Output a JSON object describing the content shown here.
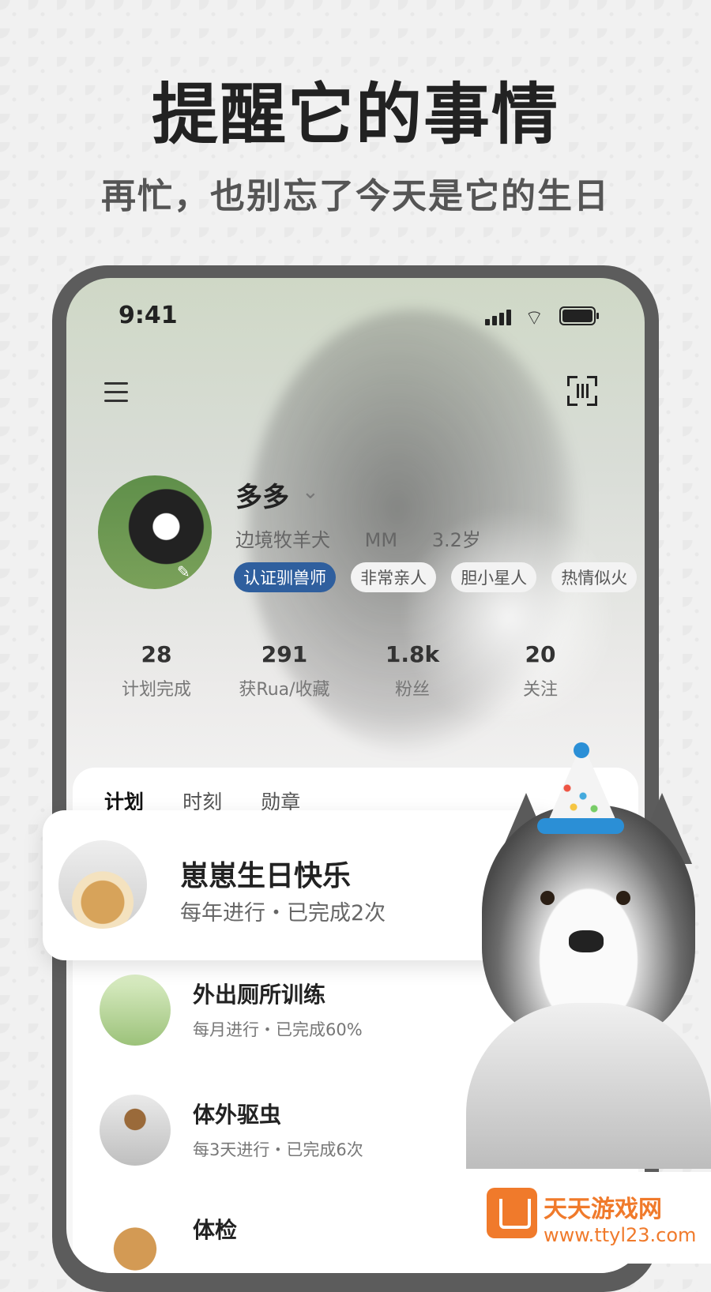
{
  "promo": {
    "headline": "提醒它的事情",
    "subheadline": "再忙，也别忘了今天是它的生日"
  },
  "statusbar": {
    "time": "9:41",
    "icons": [
      "signal-icon",
      "wifi-icon",
      "battery-icon"
    ]
  },
  "toolbar": {
    "left_icon": "menu-icon",
    "right_icon": "scan-icon"
  },
  "profile": {
    "name": "多多",
    "breed": "边境牧羊犬",
    "gender": "MM",
    "age": "3.2岁",
    "tags": [
      "认证驯兽师",
      "非常亲人",
      "胆小星人",
      "热情似火"
    ]
  },
  "stats": [
    {
      "value": "28",
      "label": "计划完成"
    },
    {
      "value": "291",
      "label": "获Rua/收藏"
    },
    {
      "value": "1.8k",
      "label": "粉丝"
    },
    {
      "value": "20",
      "label": "关注"
    }
  ],
  "tabs": [
    "计划",
    "时刻",
    "勋章"
  ],
  "highlight": {
    "title": "崽崽生日快乐",
    "subtitle": "每年进行・已完成2次"
  },
  "plans": [
    {
      "title": "外出厕所训练",
      "subtitle": "每月进行・已完成60%"
    },
    {
      "title": "体外驱虫",
      "subtitle": "每3天进行・已完成6次"
    },
    {
      "title": "体检",
      "subtitle": ""
    }
  ],
  "watermark": {
    "name": "天天游戏网",
    "url": "www.ttyl23.com"
  },
  "colors": {
    "accent_tag": "#2f5f9e",
    "watermark": "#f07a2b"
  }
}
